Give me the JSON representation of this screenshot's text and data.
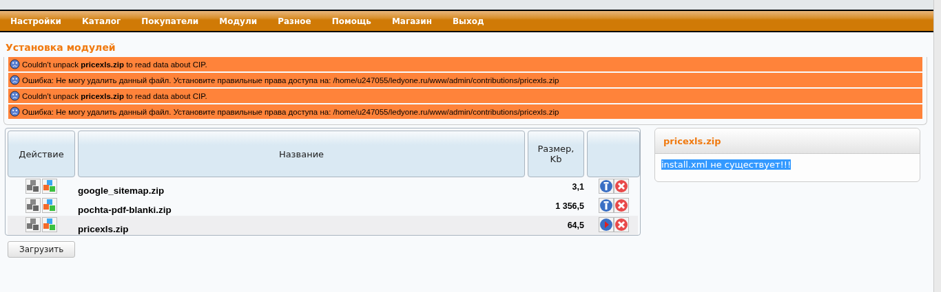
{
  "menu": [
    {
      "label": "Настройки"
    },
    {
      "label": "Каталог"
    },
    {
      "label": "Покупатели"
    },
    {
      "label": "Модули"
    },
    {
      "label": "Разное"
    },
    {
      "label": "Помощь"
    },
    {
      "label": "Магазин"
    },
    {
      "label": "Выход"
    }
  ],
  "page_title": "Установка модулей",
  "messages": [
    {
      "text": "Couldn't unpack **pricexls.zip** to read data about CIP."
    },
    {
      "text": "Ошибка: Не могу удалить данный файл. Установите правильные права доступа на: /home/u247055/ledyone.ru/www/admin/contributions/pricexls.zip"
    },
    {
      "text": "Couldn't unpack **pricexls.zip** to read data about CIP."
    },
    {
      "text": "Ошибка: Не могу удалить данный файл. Установите правильные права доступа на: /home/u247055/ledyone.ru/www/admin/contributions/pricexls.zip"
    }
  ],
  "table": {
    "columns": [
      "Действие",
      "Название",
      "Размер, Kb"
    ],
    "rows": [
      {
        "name": "google_sitemap.zip",
        "size": "3,1",
        "kind": "info",
        "selected": false
      },
      {
        "name": "pochta-pdf-blanki.zip",
        "size": "1 356,5",
        "kind": "info",
        "selected": false
      },
      {
        "name": "pricexls.zip",
        "size": "64,5",
        "kind": "play",
        "selected": true
      }
    ]
  },
  "upload_button": "Загрузить",
  "info_panel": {
    "title": "pricexls.zip",
    "text": "install.xml не существует!!!"
  }
}
